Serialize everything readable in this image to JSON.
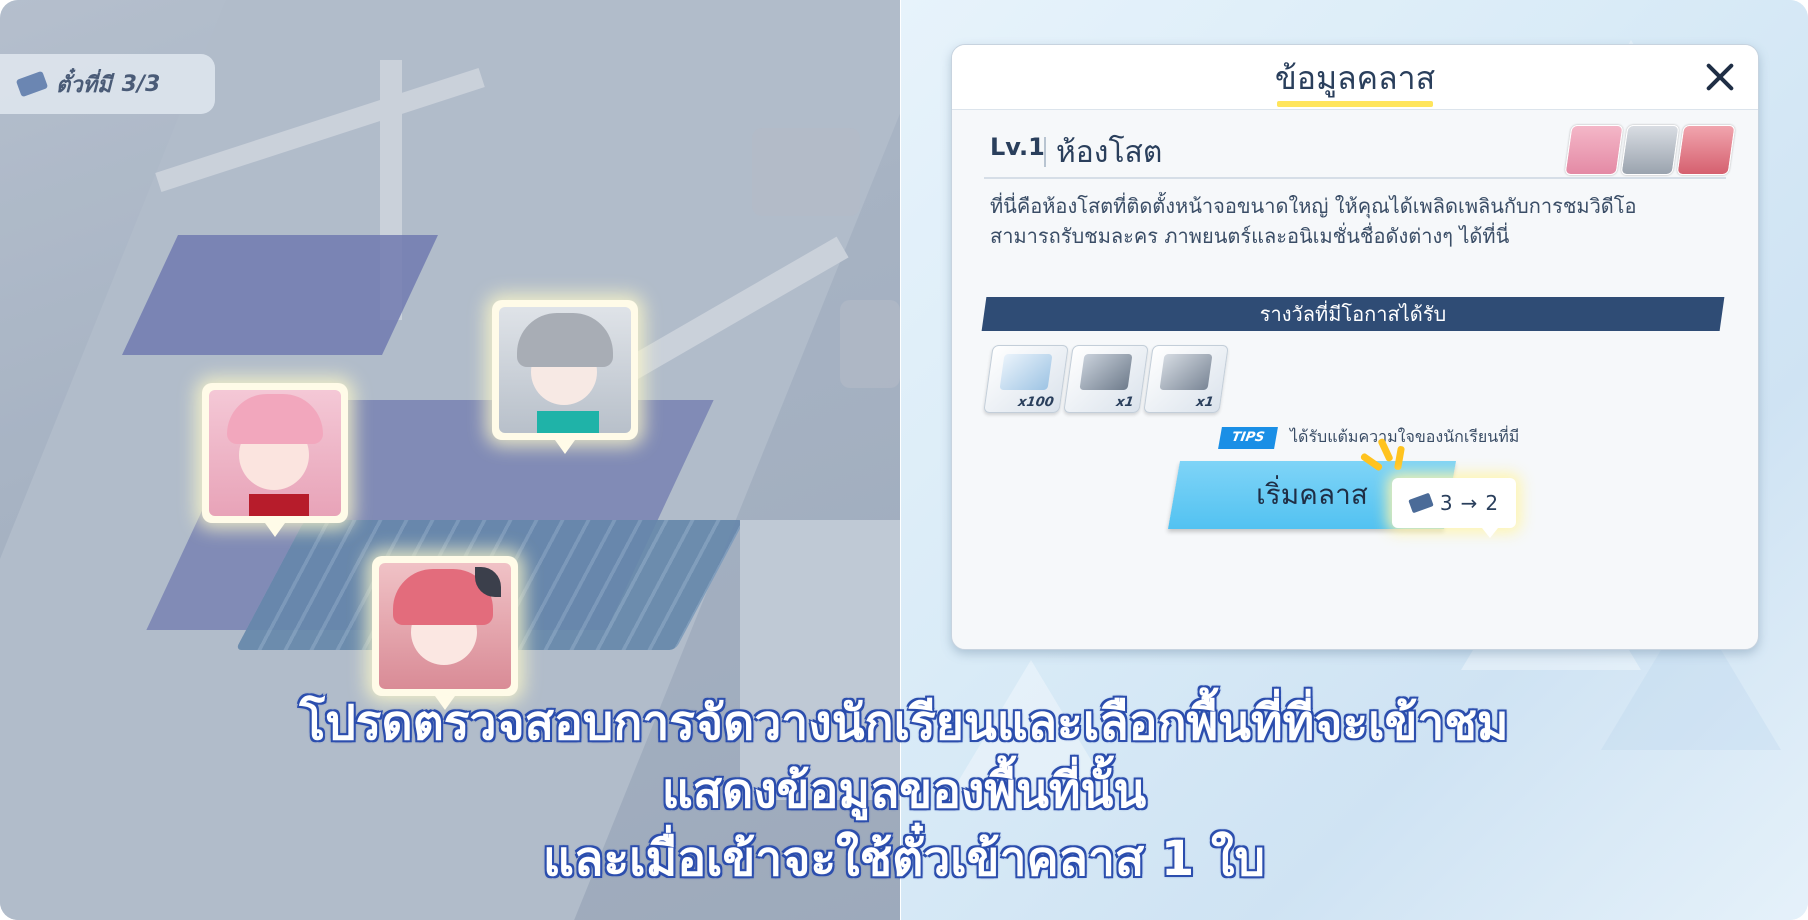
{
  "map": {
    "ticket_label": "ตั๋วที่มี",
    "ticket_count": "3/3"
  },
  "dialog": {
    "title": "ข้อมูลคลาส",
    "level": "Lv.1",
    "room_name": "ห้องโสต",
    "description_lines": [
      "ที่นี่คือห้องโสตที่ติดตั้งหน้าจอขนาดใหญ่ ให้คุณได้เพลิดเพลินกับการชมวิดีโอ",
      "สามารถรับชมละคร ภาพยนตร์และอนิเมชั่นชื่อดังต่างๆ ได้ที่นี่"
    ],
    "rewards_header": "รางวัลที่มีโอกาสได้รับ",
    "rewards": [
      {
        "icon": "exp-report-icon",
        "qty": "x100"
      },
      {
        "icon": "mystery-box-icon",
        "qty": "x1"
      },
      {
        "icon": "mystery-book-icon",
        "qty": "x1"
      }
    ],
    "tips_badge": "TIPS",
    "tips_text": "ได้รับแต้มความใจของนักเรียนที่มี",
    "ticket_cost_from": "3",
    "ticket_cost_to": "2",
    "start_button": "เริ่มคลาส"
  },
  "caption": {
    "line1": "โปรดตรวจสอบการจัดวางนักเรียนและเลือกพื้นที่ที่จะเข้าชม",
    "line2": "แสดงข้อมูลของพื้นที่นั้น",
    "line3": "และเมื่อเข้าจะใช้ตั๋วเข้าคลาส 1 ใบ"
  },
  "colors": {
    "accent": "#52c2f1",
    "header_bar": "#2f4c75",
    "caption_outline": "#2d4fae",
    "title_underline": "#ffe55c"
  }
}
